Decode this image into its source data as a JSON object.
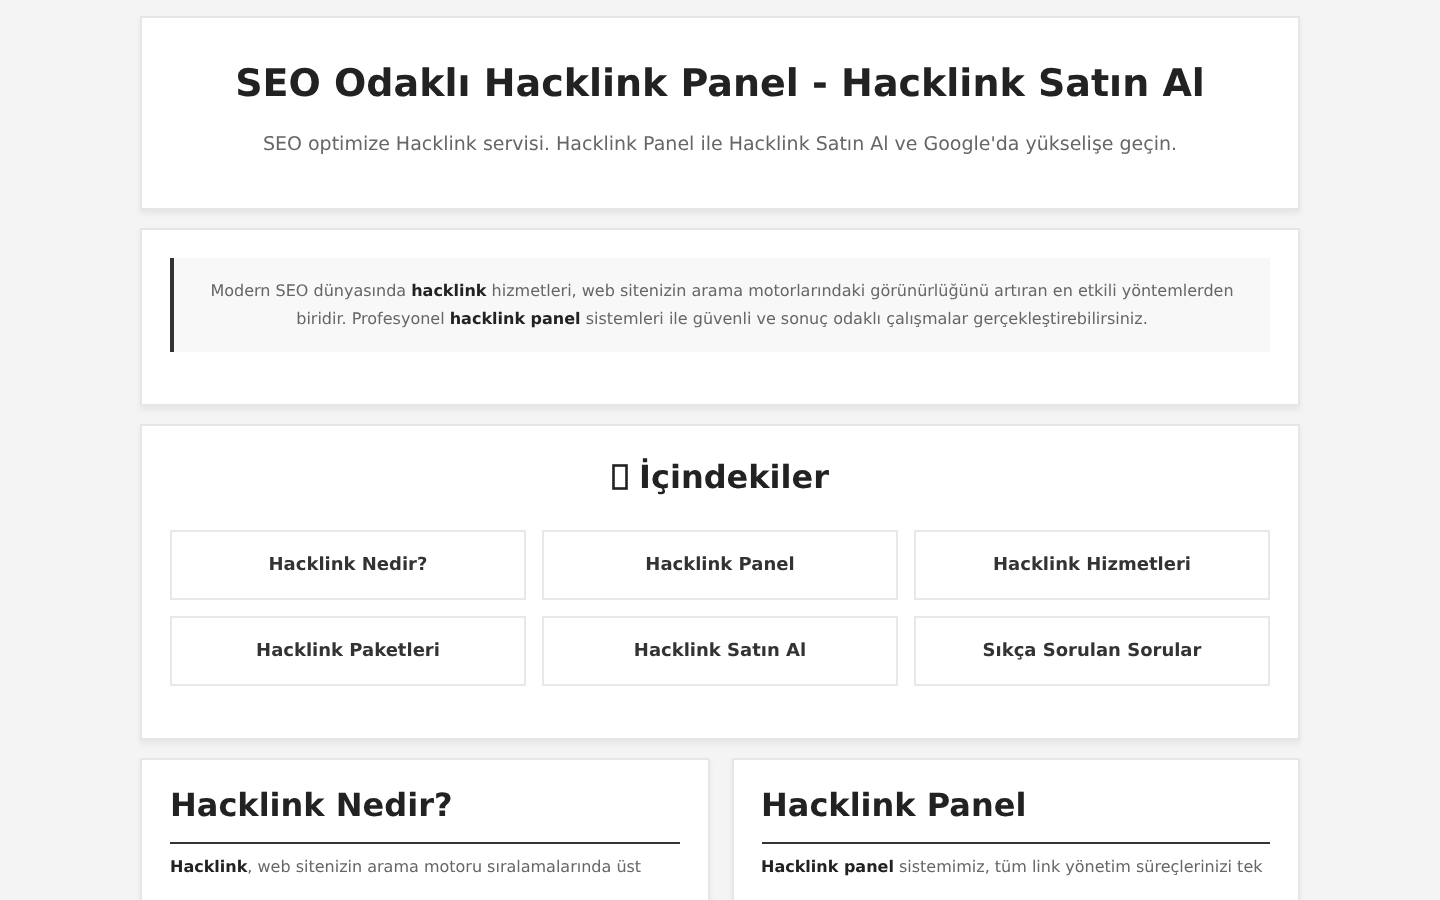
{
  "header": {
    "title": "SEO Odaklı Hacklink Panel - Hacklink Satın Al",
    "subtitle": "SEO optimize Hacklink servisi. Hacklink Panel ile Hacklink Satın Al ve Google'da yükselişe geçin."
  },
  "intro": {
    "text": "Modern SEO dünyasında **hacklink** hizmetleri, web sitenizin arama motorlarındaki görünürlüğünü artıran en etkili yöntemlerden biridir. Profesyonel **hacklink panel** sistemleri ile güvenli ve sonuç odaklı çalışmalar gerçekleştirebilirsiniz."
  },
  "toc": {
    "title": "İçindekiler",
    "items": [
      {
        "label": "Hacklink Nedir?"
      },
      {
        "label": "Hacklink Panel"
      },
      {
        "label": "Hacklink Hizmetleri"
      },
      {
        "label": "Hacklink Paketleri"
      },
      {
        "label": "Hacklink Satın Al"
      },
      {
        "label": "Sıkça Sorulan Sorular"
      }
    ]
  },
  "sections": [
    {
      "title": "Hacklink Nedir?",
      "text": "**Hacklink**, web sitenizin arama motoru sıralamalarında üst"
    },
    {
      "title": "Hacklink Panel",
      "text": "**Hacklink panel** sistemimiz, tüm link yönetim süreçlerinizi tek"
    }
  ]
}
